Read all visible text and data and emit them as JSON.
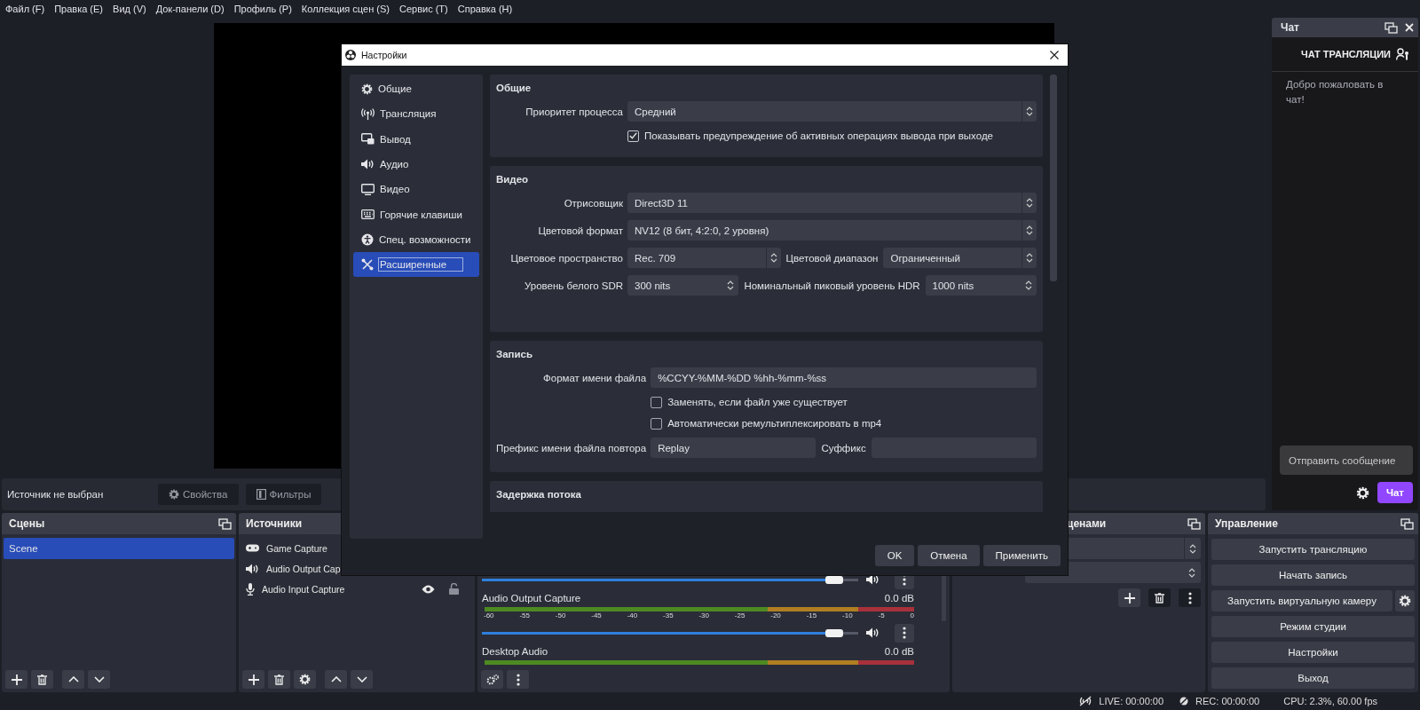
{
  "menu_bar": [
    "Файл (F)",
    "Правка (E)",
    "Вид (V)",
    "Док-панели (D)",
    "Профиль (P)",
    "Коллекция сцен (S)",
    "Сервис (T)",
    "Справка (H)"
  ],
  "context_bar": {
    "text": "Источник не выбран",
    "buttons": [
      {
        "label": "Свойства",
        "kind": "properties",
        "disabled": true
      },
      {
        "label": "Фильтры",
        "kind": "filters",
        "disabled": true
      }
    ]
  },
  "scenes": {
    "title": "Сцены",
    "items": [
      {
        "label": "Scene",
        "selected": true
      }
    ]
  },
  "sources": {
    "title": "Источники",
    "items": [
      {
        "label": "Game Capture",
        "kind": "game"
      },
      {
        "label": "Audio Output Cap",
        "kind": "audio-output"
      },
      {
        "label": "Audio Input Capture",
        "kind": "audio-input",
        "visible": true,
        "locked": false
      }
    ]
  },
  "mixer": {
    "channels": [
      {
        "kind": "slider",
        "level": 0.96,
        "muted": false
      },
      {
        "kind": "full",
        "name": "Audio Output Capture",
        "reading": "0.0 dB",
        "scale": [
          "-60",
          "-55",
          "-50",
          "-45",
          "-40",
          "-35",
          "-30",
          "-25",
          "-20",
          "-15",
          "-10",
          "-5",
          "0"
        ],
        "level": 0.96,
        "muted": false
      },
      {
        "kind": "meter",
        "name": "Desktop Audio",
        "reading": "0.0 dB"
      }
    ]
  },
  "transitions": {
    "title": "ценами"
  },
  "controls": {
    "title": "Управление",
    "buttons": [
      {
        "label": "Запустить трансляцию",
        "kind": "plain"
      },
      {
        "label": "Начать запись",
        "kind": "plain"
      },
      {
        "label": "Запустить виртуальную камеру",
        "kind": "with-settings"
      },
      {
        "label": "Режим студии",
        "kind": "plain"
      },
      {
        "label": "Настройки",
        "kind": "plain"
      },
      {
        "label": "Выход",
        "kind": "plain"
      }
    ]
  },
  "chat": {
    "title": "Чат",
    "heading": "ЧАТ ТРАНСЛЯЦИИ",
    "welcome": "Добро пожаловать в чат!",
    "input": {
      "placeholder": "Отправить сообщение"
    },
    "send_label": "Чат"
  },
  "status_bar": {
    "live": "LIVE: 00:00:00",
    "rec": "REC: 00:00:00",
    "cpu": "CPU: 2.3%, 60.00 fps"
  },
  "dialog": {
    "title": "Настройки",
    "nav": [
      {
        "label": "Общие",
        "kind": "general",
        "selected": false
      },
      {
        "label": "Трансляция",
        "kind": "stream",
        "selected": false
      },
      {
        "label": "Вывод",
        "kind": "output",
        "selected": false
      },
      {
        "label": "Аудио",
        "kind": "audio",
        "selected": false
      },
      {
        "label": "Видео",
        "kind": "video",
        "selected": false
      },
      {
        "label": "Горячие клавиши",
        "kind": "hotkeys",
        "selected": false
      },
      {
        "label": "Спец. возможности",
        "kind": "accessibility",
        "selected": false
      },
      {
        "label": "Расширенные",
        "kind": "advanced",
        "selected": true
      }
    ],
    "sections": [
      {
        "title": "Общие",
        "rows": [
          {
            "kind": "select",
            "label": "Приоритет процесса",
            "value": "Средний"
          },
          {
            "kind": "checkbox",
            "label": "Показывать предупреждение об активных операциях вывода при выходе",
            "checked": true
          }
        ]
      },
      {
        "title": "Видео",
        "rows": [
          {
            "kind": "select",
            "label": "Отрисовщик",
            "value": "Direct3D 11"
          },
          {
            "kind": "select",
            "label": "Цветовой формат",
            "value": "NV12 (8 бит, 4:2:0, 2 уровня)"
          },
          {
            "kind": "pair",
            "fields": [
              {
                "kind": "select",
                "label": "Цветовое пространство",
                "value": "Rec. 709"
              },
              {
                "kind": "select",
                "label": "Цветовой диапазон",
                "value": "Ограниченный"
              }
            ]
          },
          {
            "kind": "pair",
            "fields": [
              {
                "kind": "spin",
                "label": "Уровень белого SDR",
                "value": "300 nits"
              },
              {
                "kind": "spin",
                "label": "Номинальный пиковый уровень HDR",
                "value": "1000 nits"
              }
            ]
          }
        ]
      },
      {
        "title": "Запись",
        "rows": [
          {
            "kind": "text",
            "label": "Формат имени файла",
            "value": "%CCYY-%MM-%DD %hh-%mm-%ss"
          },
          {
            "kind": "checkbox",
            "label": "Заменять, если файл уже существует",
            "checked": false
          },
          {
            "kind": "checkbox",
            "label": "Автоматически ремультиплексировать в mp4",
            "checked": false
          },
          {
            "kind": "pair",
            "fields": [
              {
                "kind": "text",
                "label": "Префикс имени файла повтора",
                "value": "Replay"
              },
              {
                "kind": "text",
                "label": "Суффикс"
              }
            ]
          }
        ]
      },
      {
        "title": "Задержка потока"
      }
    ],
    "buttons": [
      "OK",
      "Отмена",
      "Применить"
    ]
  }
}
